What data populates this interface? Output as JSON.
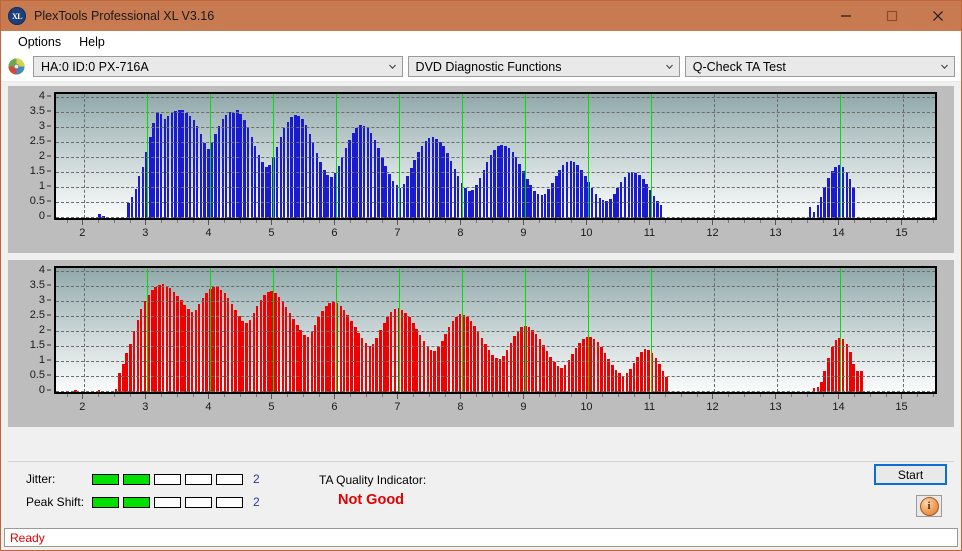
{
  "window": {
    "title": "PlexTools Professional XL V3.16",
    "logo_text": "XL",
    "minimize_icon": "minimize-icon",
    "maximize_icon": "maximize-icon",
    "close_icon": "close-icon"
  },
  "menu": {
    "items": [
      {
        "label": "Options"
      },
      {
        "label": "Help"
      }
    ]
  },
  "toolbar": {
    "drive_icon": "disc-icon",
    "drive_select": {
      "value": "HA:0 ID:0  PX-716A"
    },
    "function_select": {
      "value": "DVD Diagnostic Functions"
    },
    "test_select": {
      "value": "Q-Check TA Test"
    }
  },
  "footer": {
    "jitter_label": "Jitter:",
    "jitter_value": "2",
    "jitter_segments": 5,
    "jitter_filled": 2,
    "peak_shift_label": "Peak Shift:",
    "peak_shift_value": "2",
    "peak_shift_segments": 5,
    "peak_shift_filled": 2,
    "tqi_label": "TA Quality Indicator:",
    "tqi_value": "Not Good",
    "start_label": "Start",
    "info_icon": "info-icon",
    "info_glyph": "i"
  },
  "status": {
    "text": "Ready"
  },
  "colors": {
    "title_bar": "#c87a51",
    "jitter_bar": "#00e000",
    "marker_line": "#00e000",
    "tqi": "#e00000",
    "status": "#e00000",
    "top_series": "#1a1ad0",
    "bottom_series": "#f00000"
  },
  "chart_data": [
    {
      "type": "bar",
      "name": "jitter-chart",
      "title": "",
      "xlabel": "",
      "ylabel": "",
      "series_color": "#1a1ad0",
      "xlim": [
        1.55,
        15.5
      ],
      "ylim": [
        0,
        4.15
      ],
      "yticks": [
        0,
        0.5,
        1,
        1.5,
        2,
        2.5,
        3,
        3.5,
        4
      ],
      "ytick_labels": [
        "0",
        "0.5",
        "1",
        "1.5",
        "2",
        "2.5",
        "3",
        "3.5",
        "4"
      ],
      "xticks": [
        2,
        3,
        4,
        5,
        6,
        7,
        8,
        9,
        10,
        11,
        12,
        13,
        14,
        15
      ],
      "xtick_labels": [
        "2",
        "3",
        "4",
        "5",
        "6",
        "7",
        "8",
        "9",
        "10",
        "11",
        "12",
        "13",
        "14",
        "15"
      ],
      "grid": true,
      "marker_lines": [
        3,
        4,
        5,
        6,
        7,
        8,
        9,
        10,
        11,
        14
      ],
      "bar_step": 0.0575,
      "x": [
        2.24,
        2.3,
        2.7,
        2.76,
        2.82,
        2.87,
        2.93,
        2.99,
        3.05,
        3.1,
        3.16,
        3.22,
        3.28,
        3.33,
        3.39,
        3.45,
        3.51,
        3.56,
        3.62,
        3.68,
        3.74,
        3.79,
        3.85,
        3.91,
        3.97,
        4.02,
        4.08,
        4.14,
        4.2,
        4.25,
        4.31,
        4.37,
        4.43,
        4.48,
        4.54,
        4.6,
        4.66,
        4.71,
        4.77,
        4.83,
        4.89,
        4.94,
        5.0,
        5.06,
        5.12,
        5.17,
        5.23,
        5.29,
        5.35,
        5.4,
        5.46,
        5.52,
        5.58,
        5.63,
        5.69,
        5.75,
        5.81,
        5.86,
        5.92,
        5.98,
        6.04,
        6.09,
        6.15,
        6.21,
        6.27,
        6.32,
        6.38,
        6.44,
        6.5,
        6.55,
        6.61,
        6.67,
        6.73,
        6.78,
        6.84,
        6.9,
        6.96,
        7.01,
        7.07,
        7.13,
        7.19,
        7.24,
        7.3,
        7.36,
        7.42,
        7.47,
        7.53,
        7.59,
        7.65,
        7.7,
        7.76,
        7.82,
        7.88,
        7.93,
        7.99,
        8.05,
        8.11,
        8.16,
        8.22,
        8.28,
        8.34,
        8.39,
        8.45,
        8.51,
        8.57,
        8.62,
        8.68,
        8.74,
        8.8,
        8.85,
        8.91,
        8.97,
        9.03,
        9.08,
        9.14,
        9.2,
        9.26,
        9.31,
        9.37,
        9.43,
        9.49,
        9.54,
        9.6,
        9.66,
        9.72,
        9.77,
        9.83,
        9.89,
        9.95,
        10.0,
        10.06,
        10.12,
        10.18,
        10.23,
        10.29,
        10.35,
        10.41,
        10.46,
        10.52,
        10.58,
        10.64,
        10.69,
        10.75,
        10.81,
        10.87,
        10.92,
        10.98,
        11.04,
        11.1,
        11.15,
        13.52,
        13.58,
        13.64,
        13.69,
        13.75,
        13.81,
        13.87,
        13.92,
        13.98,
        14.04,
        14.1,
        14.15,
        14.21
      ],
      "values": [
        0.12,
        0.06,
        0.5,
        0.7,
        0.98,
        1.42,
        1.72,
        2.2,
        2.7,
        3.18,
        3.55,
        3.48,
        3.3,
        3.42,
        3.52,
        3.58,
        3.62,
        3.6,
        3.52,
        3.42,
        3.28,
        3.08,
        2.82,
        2.52,
        2.32,
        2.5,
        2.8,
        3.08,
        3.3,
        3.46,
        3.55,
        3.52,
        3.6,
        3.48,
        3.28,
        3.02,
        2.72,
        2.42,
        2.12,
        1.88,
        1.7,
        1.78,
        2.05,
        2.38,
        2.7,
        3.0,
        3.22,
        3.38,
        3.45,
        3.42,
        3.3,
        3.1,
        2.82,
        2.5,
        2.18,
        1.88,
        1.62,
        1.45,
        1.38,
        1.5,
        1.75,
        2.05,
        2.35,
        2.62,
        2.85,
        3.0,
        3.1,
        3.08,
        3.0,
        2.85,
        2.62,
        2.35,
        2.05,
        1.75,
        1.48,
        1.25,
        1.1,
        1.02,
        1.15,
        1.4,
        1.68,
        1.95,
        2.2,
        2.42,
        2.58,
        2.68,
        2.7,
        2.65,
        2.55,
        2.4,
        2.18,
        1.92,
        1.65,
        1.4,
        1.18,
        1.0,
        0.9,
        0.95,
        1.12,
        1.35,
        1.62,
        1.88,
        2.1,
        2.28,
        2.4,
        2.45,
        2.42,
        2.35,
        2.22,
        2.05,
        1.82,
        1.58,
        1.32,
        1.1,
        0.92,
        0.8,
        0.76,
        0.82,
        0.98,
        1.18,
        1.42,
        1.62,
        1.78,
        1.88,
        1.92,
        1.88,
        1.78,
        1.62,
        1.42,
        1.2,
        1.0,
        0.82,
        0.68,
        0.6,
        0.58,
        0.65,
        0.8,
        1.0,
        1.2,
        1.38,
        1.5,
        1.55,
        1.52,
        1.45,
        1.32,
        1.15,
        0.95,
        0.75,
        0.58,
        0.45,
        0.38,
        0.2,
        0.42,
        0.72,
        1.05,
        1.35,
        1.58,
        1.72,
        1.78,
        1.72,
        1.55,
        1.3,
        1.0,
        0.72
      ]
    },
    {
      "type": "bar",
      "name": "peak-shift-chart",
      "title": "",
      "xlabel": "",
      "ylabel": "",
      "series_color": "#f00000",
      "xlim": [
        1.55,
        15.5
      ],
      "ylim": [
        0,
        4.15
      ],
      "yticks": [
        0,
        0.5,
        1,
        1.5,
        2,
        2.5,
        3,
        3.5,
        4
      ],
      "ytick_labels": [
        "0",
        "0.5",
        "1",
        "1.5",
        "2",
        "2.5",
        "3",
        "3.5",
        "4"
      ],
      "xticks": [
        2,
        3,
        4,
        5,
        6,
        7,
        8,
        9,
        10,
        11,
        12,
        13,
        14,
        15
      ],
      "xtick_labels": [
        "2",
        "3",
        "4",
        "5",
        "6",
        "7",
        "8",
        "9",
        "10",
        "11",
        "12",
        "13",
        "14",
        "15"
      ],
      "grid": true,
      "marker_lines": [
        3,
        4,
        5,
        6,
        7,
        8,
        9,
        10,
        11,
        14
      ],
      "bar_step": 0.0575,
      "x": [
        1.86,
        2.23,
        2.5,
        2.56,
        2.62,
        2.67,
        2.73,
        2.79,
        2.85,
        2.9,
        2.96,
        3.02,
        3.08,
        3.13,
        3.19,
        3.25,
        3.31,
        3.36,
        3.42,
        3.48,
        3.54,
        3.59,
        3.65,
        3.71,
        3.77,
        3.82,
        3.88,
        3.94,
        4.0,
        4.05,
        4.11,
        4.17,
        4.23,
        4.28,
        4.34,
        4.4,
        4.46,
        4.51,
        4.57,
        4.63,
        4.69,
        4.74,
        4.8,
        4.86,
        4.92,
        4.97,
        5.03,
        5.09,
        5.15,
        5.2,
        5.26,
        5.32,
        5.38,
        5.43,
        5.49,
        5.55,
        5.61,
        5.66,
        5.72,
        5.78,
        5.84,
        5.89,
        5.95,
        6.01,
        6.07,
        6.12,
        6.18,
        6.24,
        6.3,
        6.35,
        6.41,
        6.47,
        6.53,
        6.58,
        6.64,
        6.7,
        6.76,
        6.81,
        6.87,
        6.93,
        6.99,
        7.04,
        7.1,
        7.16,
        7.22,
        7.27,
        7.33,
        7.39,
        7.45,
        7.5,
        7.56,
        7.62,
        7.68,
        7.73,
        7.79,
        7.85,
        7.91,
        7.96,
        8.02,
        8.08,
        8.14,
        8.19,
        8.25,
        8.31,
        8.37,
        8.42,
        8.48,
        8.54,
        8.6,
        8.65,
        8.71,
        8.77,
        8.83,
        8.88,
        8.94,
        9.0,
        9.06,
        9.11,
        9.17,
        9.23,
        9.29,
        9.34,
        9.4,
        9.46,
        9.52,
        9.57,
        9.63,
        9.69,
        9.75,
        9.8,
        9.86,
        9.92,
        9.98,
        10.03,
        10.09,
        10.15,
        10.21,
        10.26,
        10.32,
        10.38,
        10.44,
        10.49,
        10.55,
        10.61,
        10.67,
        10.72,
        10.78,
        10.84,
        10.9,
        10.95,
        11.01,
        11.07,
        11.13,
        11.18,
        11.24,
        13.58,
        13.64,
        13.7,
        13.75,
        13.81,
        13.87,
        13.93,
        13.98,
        14.04,
        14.1,
        14.16,
        14.21,
        14.27,
        14.33
      ],
      "values": [
        0.08,
        0.08,
        0.1,
        0.62,
        0.95,
        1.32,
        1.62,
        2.05,
        2.42,
        2.78,
        3.05,
        3.25,
        3.42,
        3.52,
        3.58,
        3.6,
        3.55,
        3.48,
        3.35,
        3.22,
        3.08,
        2.92,
        2.78,
        2.68,
        2.75,
        2.95,
        3.15,
        3.32,
        3.45,
        3.52,
        3.5,
        3.42,
        3.3,
        3.15,
        2.95,
        2.75,
        2.55,
        2.38,
        2.3,
        2.42,
        2.65,
        2.88,
        3.08,
        3.25,
        3.35,
        3.38,
        3.3,
        3.18,
        3.02,
        2.85,
        2.65,
        2.45,
        2.25,
        2.08,
        1.92,
        1.85,
        2.0,
        2.25,
        2.5,
        2.72,
        2.88,
        2.98,
        3.02,
        2.98,
        2.88,
        2.75,
        2.58,
        2.38,
        2.18,
        1.98,
        1.8,
        1.65,
        1.55,
        1.62,
        1.82,
        2.08,
        2.32,
        2.52,
        2.68,
        2.78,
        2.8,
        2.75,
        2.65,
        2.5,
        2.32,
        2.12,
        1.92,
        1.72,
        1.55,
        1.42,
        1.38,
        1.5,
        1.7,
        1.95,
        2.18,
        2.38,
        2.52,
        2.6,
        2.58,
        2.5,
        2.38,
        2.22,
        2.02,
        1.82,
        1.62,
        1.42,
        1.25,
        1.15,
        1.1,
        1.22,
        1.42,
        1.65,
        1.88,
        2.05,
        2.18,
        2.22,
        2.18,
        2.08,
        1.95,
        1.78,
        1.58,
        1.38,
        1.18,
        1.02,
        0.88,
        0.82,
        0.9,
        1.08,
        1.28,
        1.48,
        1.65,
        1.78,
        1.85,
        1.85,
        1.78,
        1.68,
        1.52,
        1.32,
        1.12,
        0.92,
        0.75,
        0.62,
        0.55,
        0.62,
        0.78,
        0.98,
        1.18,
        1.35,
        1.45,
        1.42,
        1.32,
        1.15,
        0.95,
        0.72,
        0.5,
        0.12,
        0.18,
        0.35,
        0.72,
        1.15,
        1.52,
        1.75,
        1.82,
        1.78,
        1.62,
        1.35,
        0.95,
        0.72,
        0.7,
        0.3
      ]
    }
  ]
}
